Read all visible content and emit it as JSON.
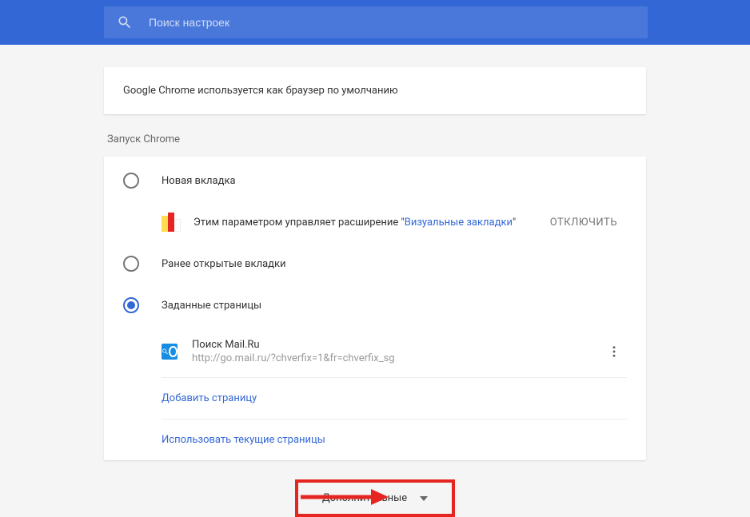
{
  "header": {
    "search_placeholder": "Поиск настроек"
  },
  "default_browser": {
    "text": "Google Chrome используется как браузер по умолчанию"
  },
  "startup": {
    "section_title": "Запуск Chrome",
    "options": {
      "new_tab": "Новая вкладка",
      "continue": "Ранее открытые вкладки",
      "specific": "Заданные страницы"
    },
    "extension_notice": {
      "prefix": "Этим параметром управляет расширение \"",
      "name": "Визуальные закладки",
      "suffix": "\"",
      "disable": "ОТКЛЮЧИТЬ"
    },
    "pages": [
      {
        "title": "Поиск Mail.Ru",
        "url": "http://go.mail.ru/?chverfix=1&fr=chverfix_sg"
      }
    ],
    "add_page": "Добавить страницу",
    "use_current": "Использовать текущие страницы"
  },
  "additional": {
    "label": "Дополнительные"
  }
}
